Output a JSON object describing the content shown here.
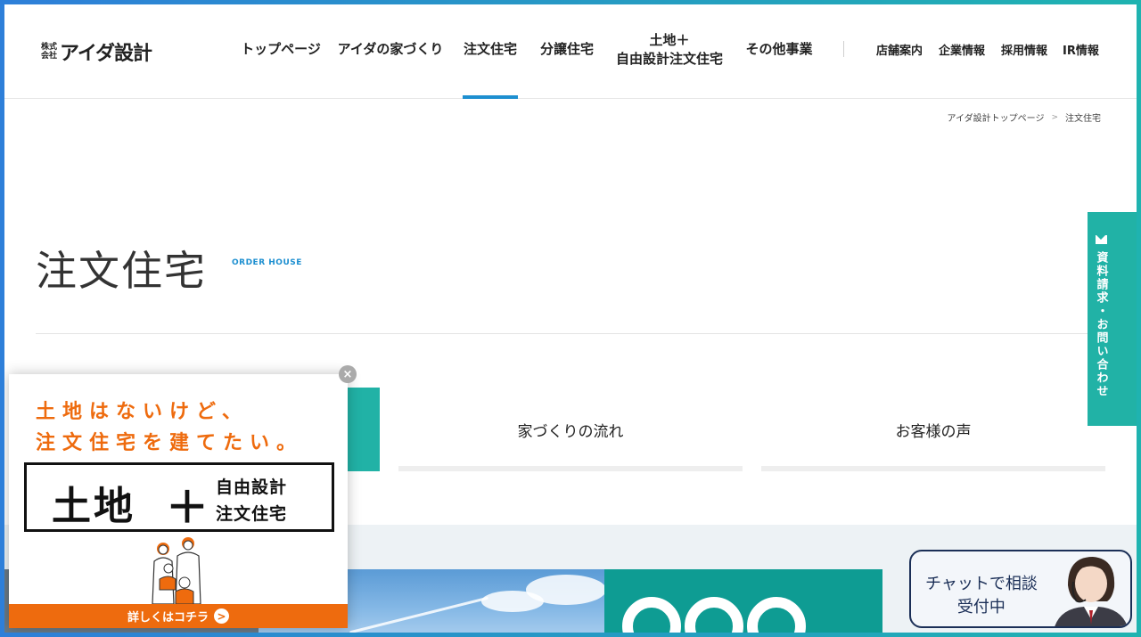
{
  "header": {
    "logo_small_top": "株式",
    "logo_small_bottom": "会社",
    "logo_main": "アイダ設計",
    "nav": [
      {
        "label": "トップページ"
      },
      {
        "label": "アイダの家づくり"
      },
      {
        "label": "注文住宅"
      },
      {
        "label": "分譲住宅"
      },
      {
        "label_line1": "土地＋",
        "label_line2": "自由設計注文住宅"
      },
      {
        "label": "その他事業"
      }
    ],
    "subnav": [
      "店舗案内",
      "企業情報",
      "採用情報",
      "IR情報"
    ]
  },
  "breadcrumb": {
    "home": "アイダ設計トップページ",
    "separator": ">",
    "current": "注文住宅"
  },
  "page": {
    "title": "注文住宅",
    "subtitle": "ORDER HOUSE"
  },
  "tabs": [
    {
      "label": ""
    },
    {
      "label": "家づくりの流れ"
    },
    {
      "label": "お客様の声"
    }
  ],
  "side_tab": {
    "icon": "mail-icon",
    "label": "資料請求・お問い合わせ"
  },
  "popup": {
    "close_label": "×",
    "line1": "土地はないけど、",
    "line2": "注文住宅を建てたい。",
    "box_left": "土地",
    "box_plus": "＋",
    "box_right_line1": "自由設計",
    "box_right_line2": "注文住宅",
    "cta_label": "詳しくはコチラ",
    "cta_arrow": ">"
  },
  "chat": {
    "line1": "チャットで相談",
    "line2": "受付中"
  },
  "colors": {
    "accent_blue": "#1d8fd0",
    "teal": "#21b2a6",
    "orange": "#ee6b0e",
    "navy": "#1b2f57"
  }
}
